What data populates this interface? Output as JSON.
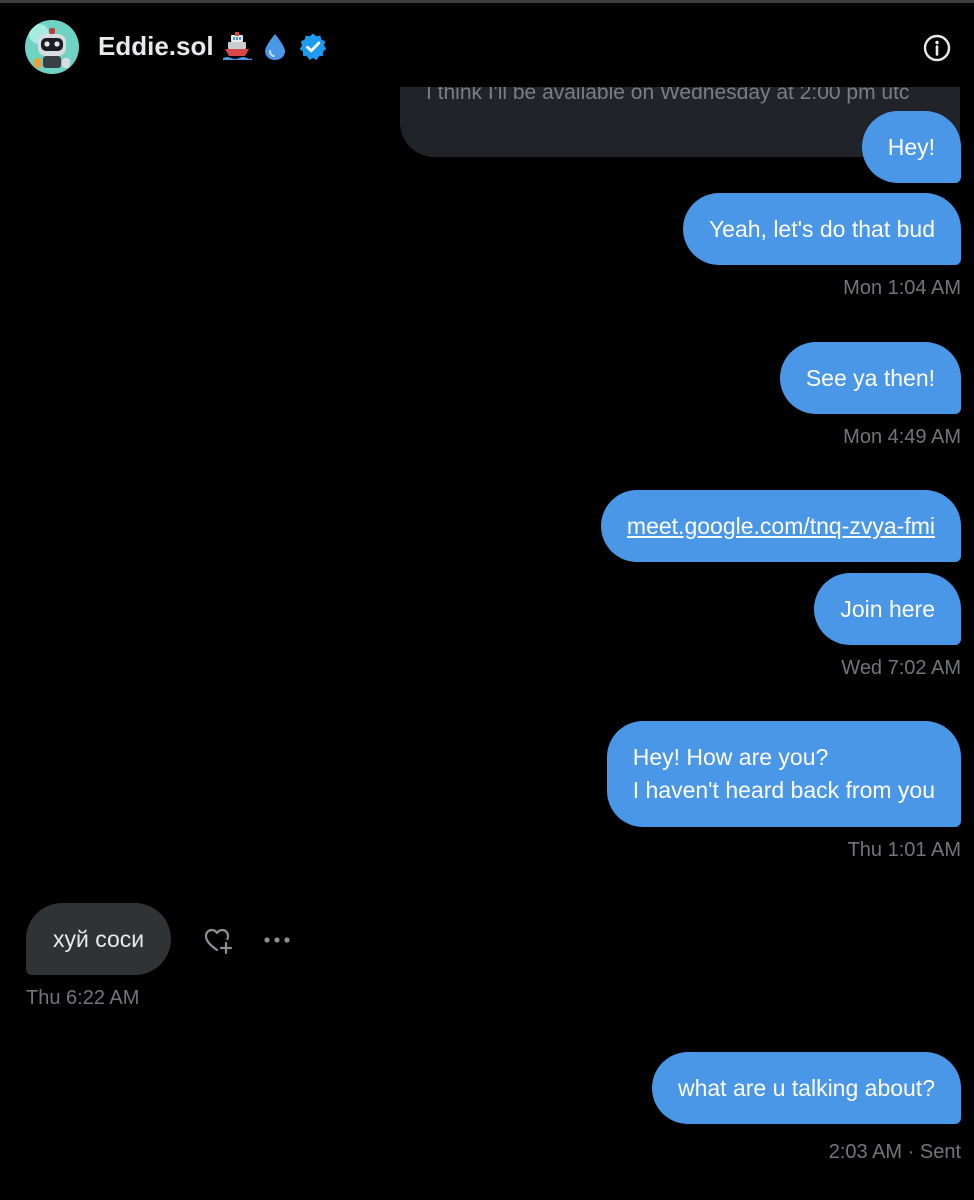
{
  "header": {
    "name": "Eddie.sol",
    "emoji_icons": [
      "ship-icon",
      "droplet-icon"
    ],
    "verified_icon": "verified-badge-icon",
    "info_icon": "info-icon"
  },
  "conversation": {
    "ghost_text": "I think I'll be available on Wednesday at 2:00 pm utc",
    "messages": [
      {
        "text": "Hey!"
      },
      {
        "text": "Yeah, let's do that bud"
      },
      {
        "timestamp": "Mon 1:04 AM"
      },
      {
        "text": "See ya then!"
      },
      {
        "timestamp": "Mon 4:49 AM"
      },
      {
        "text": "meet.google.com/tnq-zvya-fmi"
      },
      {
        "text": "Join here"
      },
      {
        "timestamp": "Wed 7:02 AM"
      },
      {
        "line1": "Hey! How are you?",
        "line2": "I haven't heard back from you"
      },
      {
        "timestamp": "Thu 1:01 AM"
      },
      {
        "text": "хуй соси"
      },
      {
        "timestamp": "Thu 6:22 AM"
      },
      {
        "text": "what are u talking about?"
      },
      {
        "timestamp": "2:03 AM · Sent"
      }
    ]
  },
  "colors": {
    "background": "#000000",
    "outgoing_bubble": "#4a97e8",
    "incoming_bubble": "#2f3336",
    "timestamp": "#71767b",
    "verified": "#1d9bf0"
  }
}
